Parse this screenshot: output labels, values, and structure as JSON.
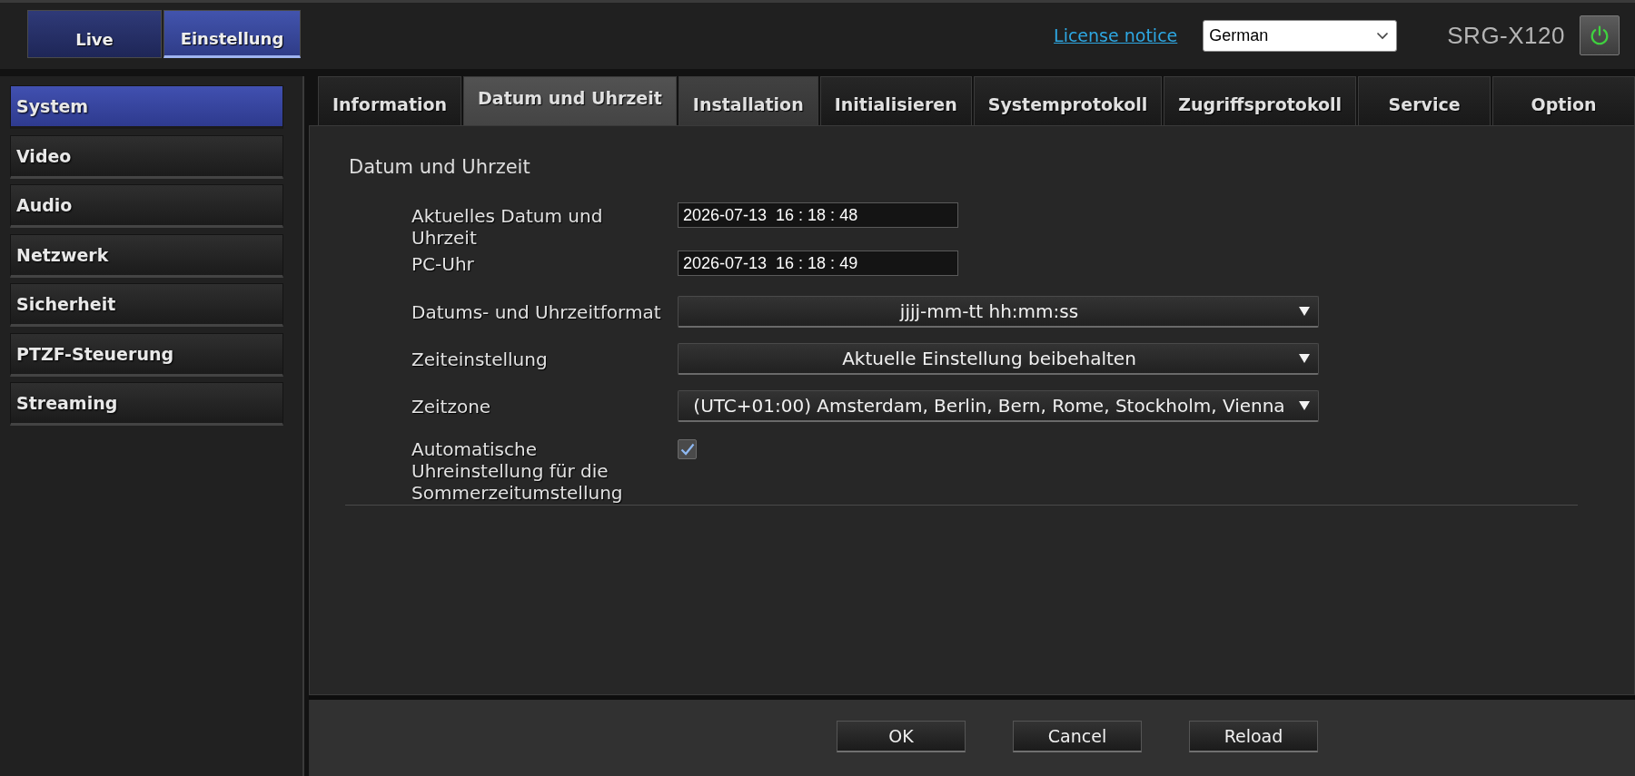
{
  "header": {
    "mode_tabs": [
      {
        "label": "Live",
        "selected": false
      },
      {
        "label": "Einstellung",
        "selected": true
      }
    ],
    "license_link": "License notice",
    "language_select": {
      "value": "German"
    },
    "model_name": "SRG-X120"
  },
  "sidebar": {
    "items": [
      {
        "label": "System",
        "selected": true
      },
      {
        "label": "Video",
        "selected": false
      },
      {
        "label": "Audio",
        "selected": false
      },
      {
        "label": "Netzwerk",
        "selected": false
      },
      {
        "label": "Sicherheit",
        "selected": false
      },
      {
        "label": "PTZF-Steuerung",
        "selected": false
      },
      {
        "label": "Streaming",
        "selected": false
      }
    ]
  },
  "tabs": [
    {
      "label": "Information",
      "selected": false,
      "highlighted": false
    },
    {
      "label": "Datum und Uhrzeit",
      "selected": true,
      "highlighted": false
    },
    {
      "label": "Installation",
      "selected": false,
      "highlighted": true
    },
    {
      "label": "Initialisieren",
      "selected": false,
      "highlighted": false
    },
    {
      "label": "Systemprotokoll",
      "selected": false,
      "highlighted": false
    },
    {
      "label": "Zugriffsprotokoll",
      "selected": false,
      "highlighted": false
    },
    {
      "label": "Service",
      "selected": false,
      "highlighted": false
    },
    {
      "label": "Option",
      "selected": false,
      "highlighted": false
    }
  ],
  "panel": {
    "heading": "Datum und Uhrzeit",
    "fields": [
      {
        "kind": "text",
        "label": "Aktuelles Datum und Uhrzeit",
        "value": "2026-07-13  16 : 18 : 48"
      },
      {
        "kind": "text",
        "label": "PC-Uhr",
        "value": "2026-07-13  16 : 18 : 49"
      },
      {
        "kind": "select",
        "label": "Datums- und Uhrzeitformat",
        "value": "jjjj-mm-tt hh:mm:ss"
      },
      {
        "kind": "select",
        "label": "Zeiteinstellung",
        "value": "Aktuelle Einstellung beibehalten"
      },
      {
        "kind": "select",
        "label": "Zeitzone",
        "value": "(UTC+01:00) Amsterdam, Berlin, Bern, Rome, Stockholm, Vienna"
      },
      {
        "kind": "checkbox",
        "label": "Automatische Uhreinstellung für die Sommerzeitumstellung",
        "checked": true
      }
    ]
  },
  "buttons": [
    "OK",
    "Cancel",
    "Reload"
  ]
}
